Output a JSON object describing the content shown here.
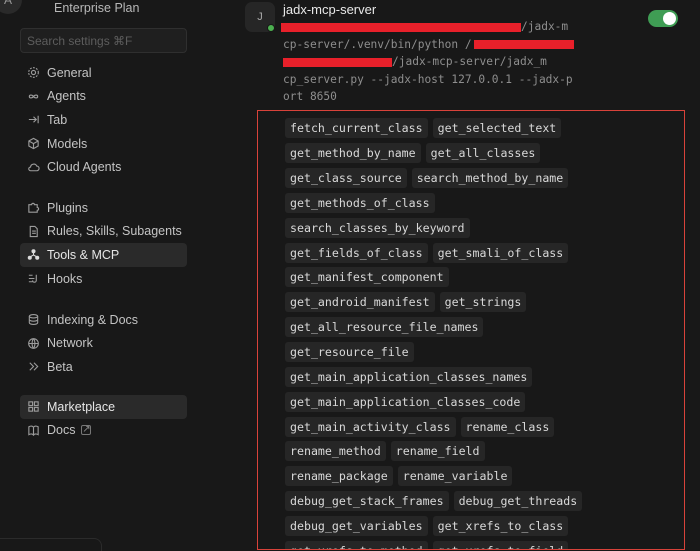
{
  "sidebar": {
    "avatar_letter": "A",
    "plan": "Enterprise Plan",
    "search_placeholder": "Search settings ⌘F",
    "groups": [
      [
        {
          "label": "General",
          "icon": "gear-icon"
        },
        {
          "label": "Agents",
          "icon": "infinity-icon"
        },
        {
          "label": "Tab",
          "icon": "tab-arrow-icon"
        },
        {
          "label": "Models",
          "icon": "cube-icon"
        },
        {
          "label": "Cloud Agents",
          "icon": "cloud-icon"
        }
      ],
      [
        {
          "label": "Plugins",
          "icon": "puzzle-icon"
        },
        {
          "label": "Rules, Skills, Subagents",
          "icon": "document-icon"
        },
        {
          "label": "Tools & MCP",
          "icon": "nodes-icon",
          "active": true
        },
        {
          "label": "Hooks",
          "icon": "hook-icon"
        }
      ],
      [
        {
          "label": "Indexing & Docs",
          "icon": "database-icon"
        },
        {
          "label": "Network",
          "icon": "globe-icon"
        },
        {
          "label": "Beta",
          "icon": "chevrons-icon"
        }
      ],
      [
        {
          "label": "Marketplace",
          "icon": "grid-icon",
          "active": true
        },
        {
          "label": "Docs",
          "icon": "book-icon",
          "external": true
        }
      ]
    ]
  },
  "server": {
    "icon_letter": "J",
    "name": "jadx-mcp-server",
    "enabled": true,
    "status_color": "#4cb050",
    "toggle_color": "#3f9d54",
    "command_lines": [
      "/jadx-m",
      "cp-server/.venv/bin/python /",
      "/jadx-mcp-server/jadx_m",
      "cp_server.py --jadx-host 127.0.0.1 --jadx-p",
      "ort 8650"
    ],
    "redaction_color": "#e8202a"
  },
  "tools_highlight_color": "#d8423a",
  "tools": [
    [
      "fetch_current_class",
      "get_selected_text"
    ],
    [
      "get_method_by_name",
      "get_all_classes"
    ],
    [
      "get_class_source",
      "search_method_by_name"
    ],
    [
      "get_methods_of_class"
    ],
    [
      "search_classes_by_keyword"
    ],
    [
      "get_fields_of_class",
      "get_smali_of_class"
    ],
    [
      "get_manifest_component"
    ],
    [
      "get_android_manifest",
      "get_strings"
    ],
    [
      "get_all_resource_file_names"
    ],
    [
      "get_resource_file"
    ],
    [
      "get_main_application_classes_names"
    ],
    [
      "get_main_application_classes_code"
    ],
    [
      "get_main_activity_class",
      "rename_class"
    ],
    [
      "rename_method",
      "rename_field"
    ],
    [
      "rename_package",
      "rename_variable"
    ],
    [
      "debug_get_stack_frames",
      "debug_get_threads"
    ],
    [
      "debug_get_variables",
      "get_xrefs_to_class"
    ],
    [
      "get_xrefs_to_method",
      "get_xrefs_to_field"
    ]
  ]
}
